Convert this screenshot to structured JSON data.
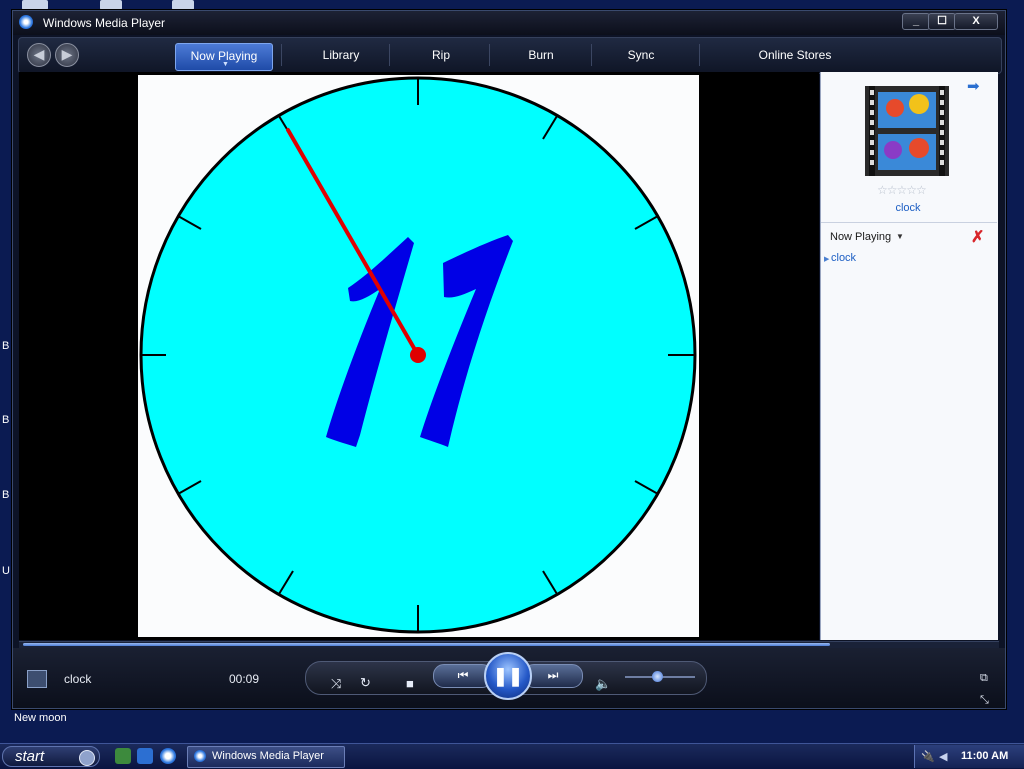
{
  "window": {
    "title": "Windows Media Player",
    "controls": {
      "minimize": "_",
      "maximize": "☐",
      "close": "X"
    }
  },
  "nav": {
    "back_icon": "back-arrow-icon",
    "forward_icon": "forward-arrow-icon",
    "tabs": [
      {
        "label": "Now Playing",
        "active": true
      },
      {
        "label": "Library"
      },
      {
        "label": "Rip"
      },
      {
        "label": "Burn"
      },
      {
        "label": "Sync"
      },
      {
        "label": "Online Stores"
      }
    ]
  },
  "video": {
    "clock_face_color": "#00ffff",
    "hand_color": "#e00000",
    "numeral_color": "#0000e6",
    "numeral": "11"
  },
  "side_panel": {
    "media_title": "clock",
    "rating_stars": "☆☆☆☆☆",
    "playlist_label": "Now Playing",
    "playlist_items": [
      "clock"
    ]
  },
  "playback": {
    "track_name": "clock",
    "elapsed": "00:09",
    "progress_fraction": 0.83,
    "volume_fraction": 0.45
  },
  "desktop": {
    "status_text": "New moon",
    "left_edge_letters": [
      "B",
      "B",
      "B",
      "U"
    ]
  },
  "taskbar": {
    "start_label": "start",
    "task_button": "Windows Media Player",
    "clock": "11:00 AM"
  }
}
